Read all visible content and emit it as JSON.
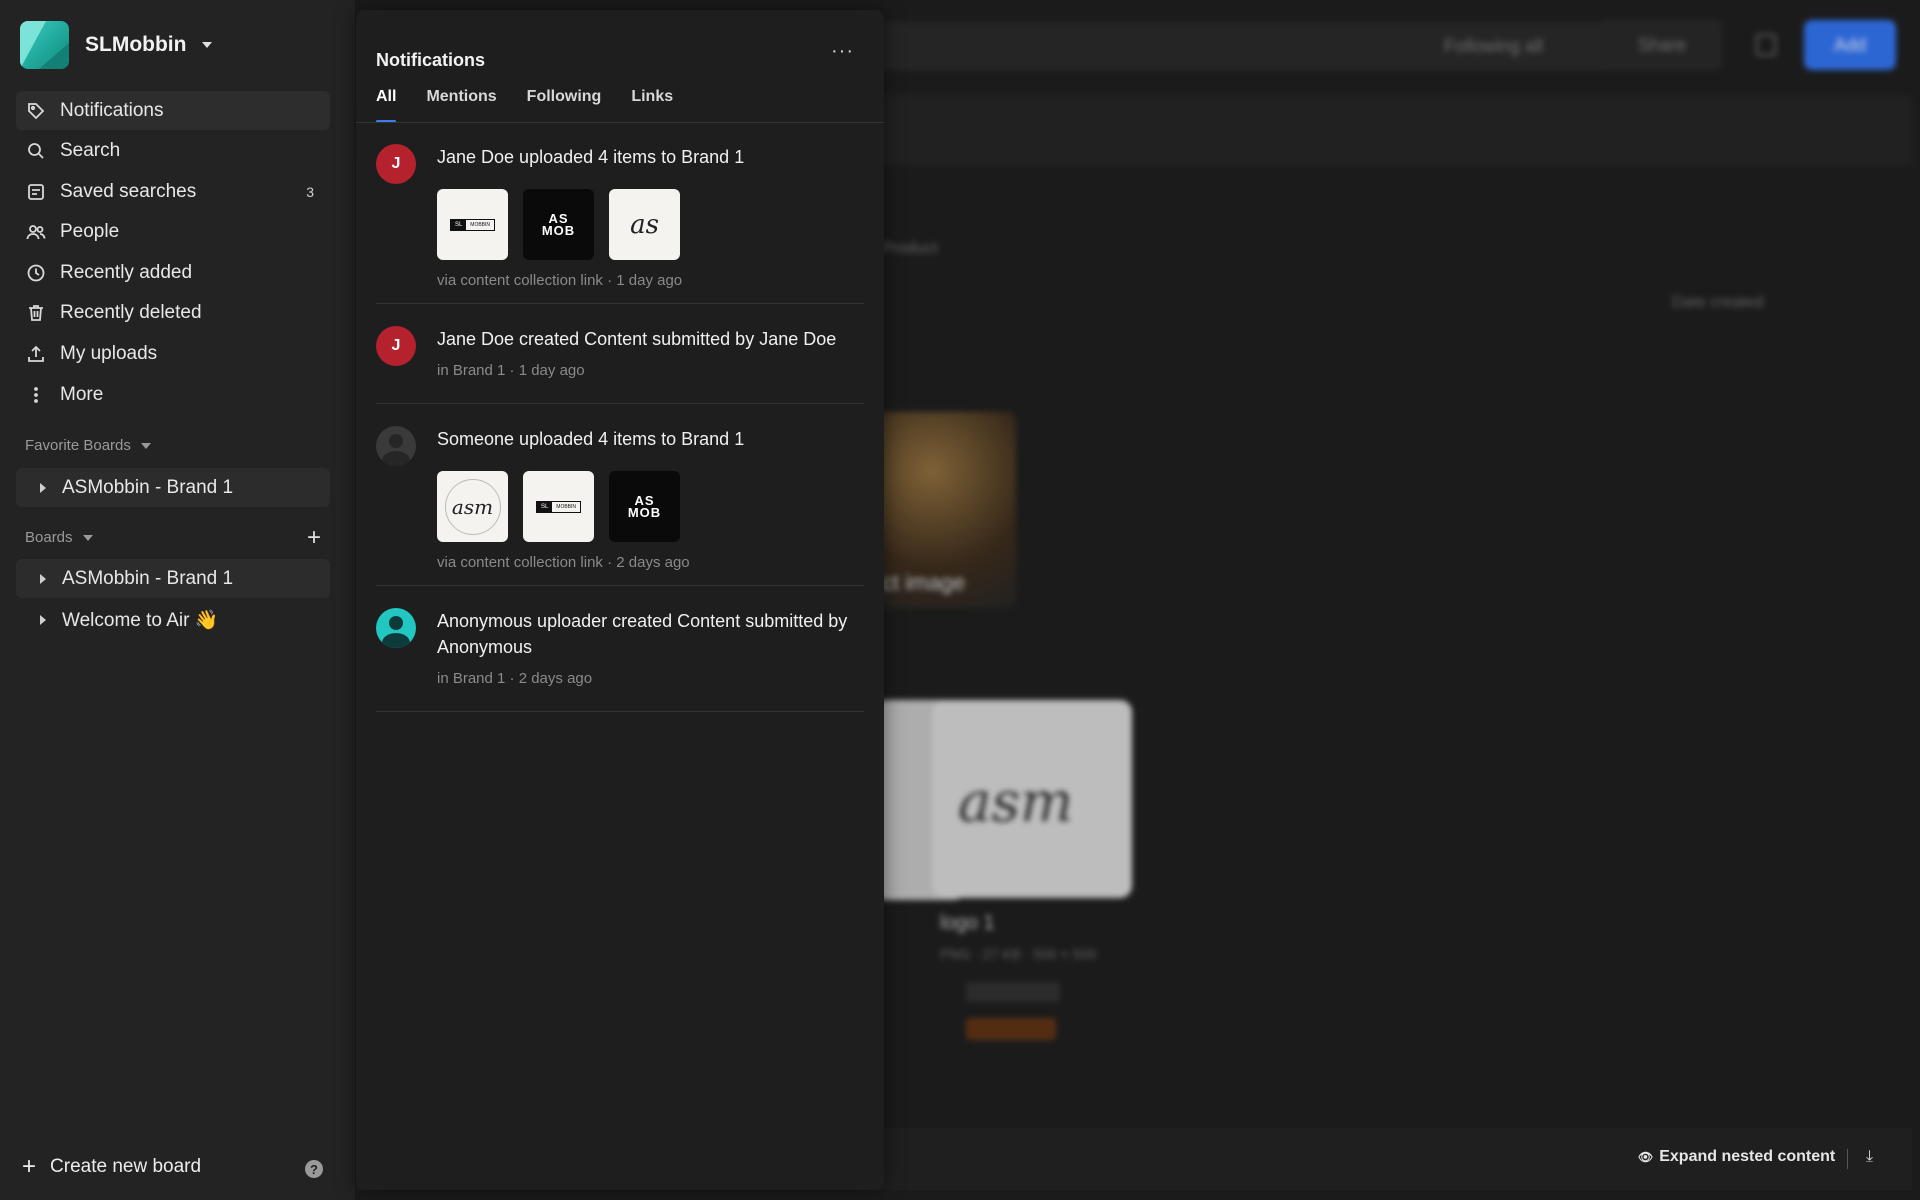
{
  "workspace": {
    "name": "SLMobbin"
  },
  "nav": {
    "items": [
      {
        "label": "Notifications",
        "icon": "tag-icon"
      },
      {
        "label": "Search",
        "icon": "search-icon"
      },
      {
        "label": "Saved searches",
        "icon": "saved-search-icon",
        "count": "3"
      },
      {
        "label": "People",
        "icon": "people-icon"
      },
      {
        "label": "Recently added",
        "icon": "clock-icon"
      },
      {
        "label": "Recently deleted",
        "icon": "trash-icon"
      },
      {
        "label": "My uploads",
        "icon": "upload-icon"
      },
      {
        "label": "More",
        "icon": "more-vertical-icon"
      }
    ]
  },
  "favorites": {
    "label": "Favorite Boards",
    "items": [
      {
        "label": "ASMobbin - Brand 1"
      }
    ]
  },
  "boards": {
    "label": "Boards",
    "items": [
      {
        "label": "ASMobbin - Brand 1"
      },
      {
        "label": "Welcome to Air 👋"
      }
    ]
  },
  "footer": {
    "create_label": "Create new board",
    "help_label": "?"
  },
  "background": {
    "following": "Following all",
    "share": "Share",
    "add": "Add",
    "product": "Product",
    "date_created": "Date created",
    "photo_text": "ct image",
    "asm_text": "asm",
    "card_title": "logo 1",
    "card_meta": "PNG · 27 KB · 500 × 500"
  },
  "bottom": {
    "expand_label": "Expand nested content"
  },
  "notifications": {
    "title": "Notifications",
    "tabs": [
      "All",
      "Mentions",
      "Following",
      "Links"
    ],
    "entries": [
      {
        "avatar": "J",
        "text": "Jane Doe uploaded 4 items to Brand 1",
        "sub": "via content collection link · 1 day ago"
      },
      {
        "avatar": "J",
        "text": "Jane Doe created Content submitted by Jane Doe",
        "sub": "in Brand 1 · 1 day ago"
      },
      {
        "avatar": "",
        "text": "Someone uploaded 4 items to Brand 1",
        "sub": "via content collection link · 2 days ago"
      },
      {
        "avatar": "",
        "text": "Anonymous uploader created Content submitted by Anonymous",
        "sub": "in Brand 1 · 2 days ago"
      }
    ],
    "thumb_text": {
      "sl": "SL",
      "mobbin": "MOBBIN",
      "as": "AS",
      "mob": "MOB",
      "as_script": "as",
      "asm_script": "asm"
    }
  },
  "colors": {
    "accent": "#3b7cf0",
    "avatar_red": "#b5222e",
    "avatar_teal": "#22c7c2",
    "add_button": "#2f6fe8"
  }
}
